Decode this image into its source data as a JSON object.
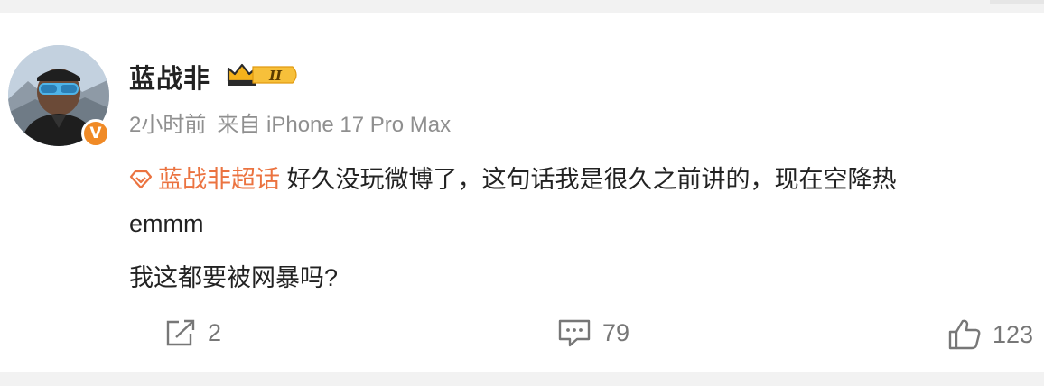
{
  "post": {
    "author": "蓝战非",
    "level_badge": "II",
    "verified_mark": "V",
    "time": "2小时前",
    "source": "来自 iPhone 17 Pro Max",
    "topic": "蓝战非超话",
    "text_line1": "好久没玩微博了，这句话我是很久之前讲的，现在空降热",
    "text_line2": "emmm",
    "text_line3": "我这都要被网暴吗?"
  },
  "actions": {
    "repost_count": "2",
    "comment_count": "79",
    "like_count": "123"
  },
  "icons": {
    "avatar": "avatar-photo",
    "verified": "orange-v-icon",
    "level": "crown-level-icon",
    "topic": "supertopic-diamond-icon",
    "repost": "repost-icon",
    "comment": "comment-icon",
    "like": "thumbs-up-icon"
  },
  "colors": {
    "topic": "#eb7340",
    "verified": "#f08a26",
    "meta": "#8f8f8f",
    "action": "#777777",
    "level_gold": "#f5b21c"
  }
}
